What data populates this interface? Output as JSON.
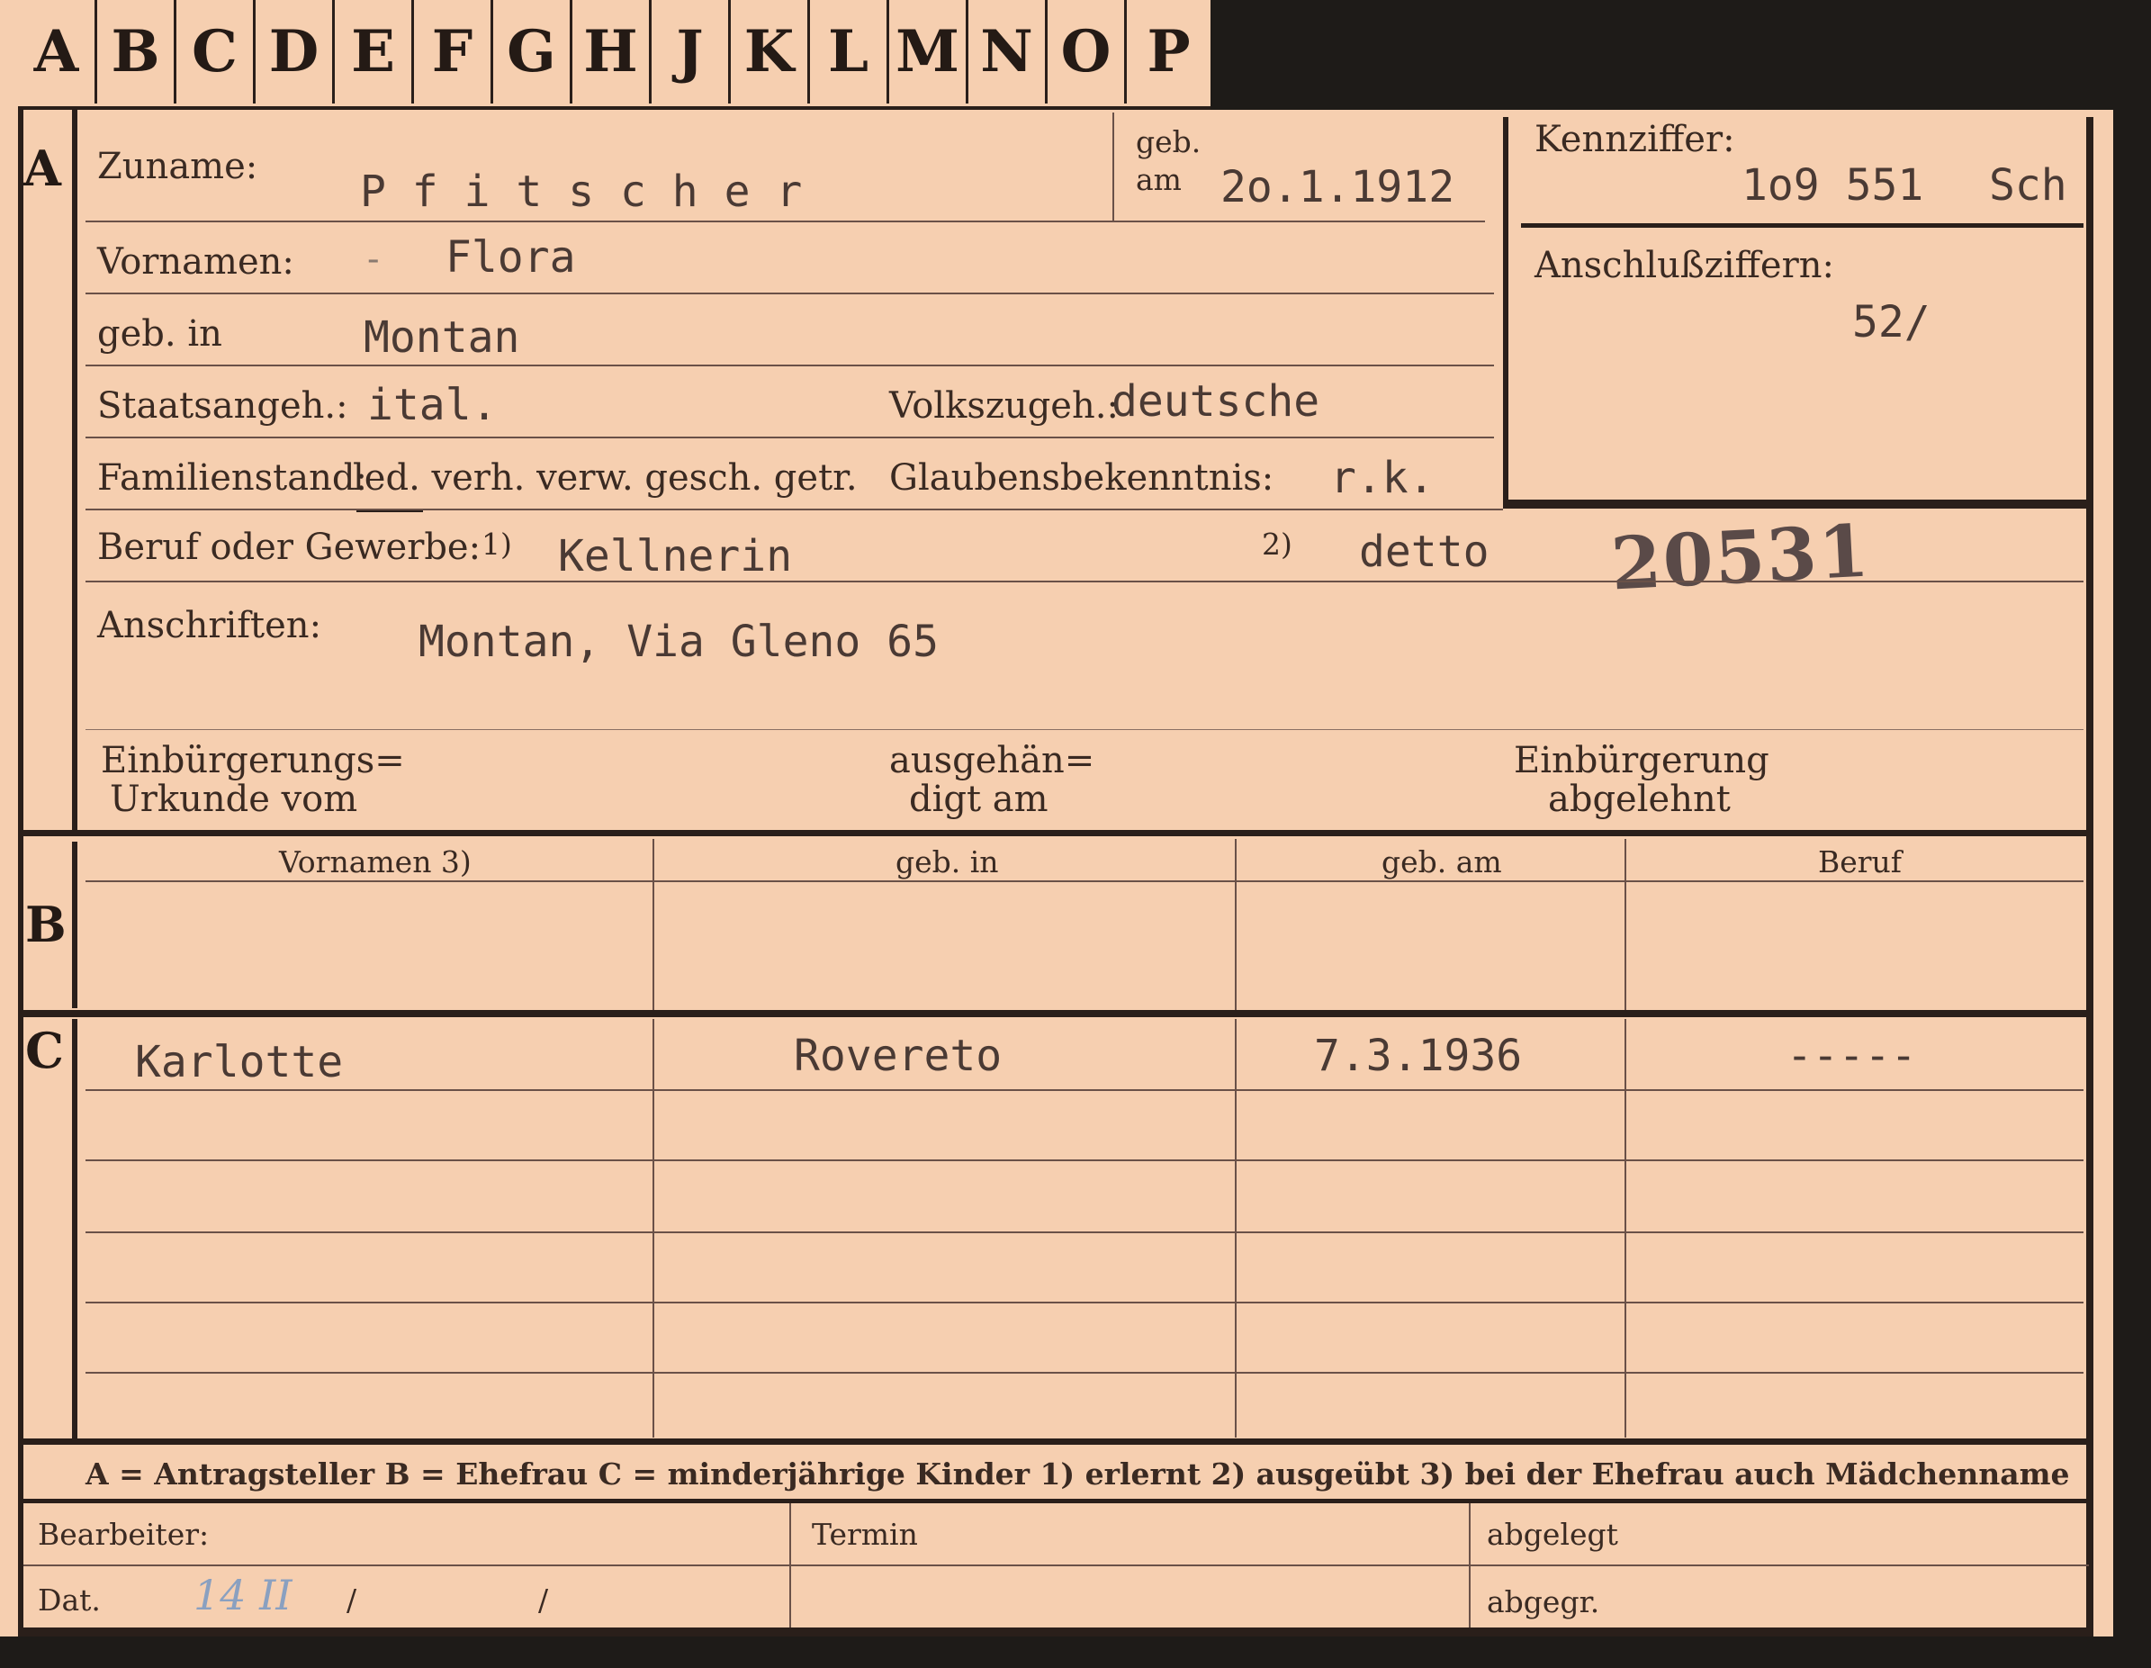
{
  "tabs": [
    "A",
    "B",
    "C",
    "D",
    "E",
    "F",
    "G",
    "H",
    "J",
    "K",
    "L",
    "M",
    "N",
    "O",
    "P"
  ],
  "sections": {
    "a": "A",
    "b": "B",
    "c": "C"
  },
  "applicant": {
    "surname_label": "Zuname:",
    "surname_value": "P f i t s c h e r",
    "born_label_top": "geb.",
    "born_label_bottom": "am",
    "born_value": "2o.1.1912",
    "first_names_label": "Vornamen:",
    "first_names_dash": "-",
    "first_names_value": "Flora",
    "birthplace_label": "geb. in",
    "birthplace_value": "Montan",
    "citizenship_label": "Staatsangeh.:",
    "citizenship_value": "ital.",
    "ethnicity_label": "Volkszugeh.:",
    "ethnicity_value": "deutsche",
    "marital_label": "Familienstand:",
    "marital_options": "led. verh. verw. gesch. getr.",
    "religion_label": "Glaubensbekenntnis:",
    "religion_value": "r.k.",
    "occupation_label": "Beruf oder Gewerbe:",
    "occupation_note1": "1)",
    "occupation_value": "Kellnerin",
    "occupation_note2": "2)",
    "occupation_value2": "detto",
    "address_label": "Anschriften:",
    "address_value": "Montan, Via Gleno 65",
    "naturalization_doc_label_1": "Einbürgerungs=",
    "naturalization_doc_label_2": "Urkunde vom",
    "handed_label_1": "ausgehän=",
    "handed_label_2": "digt am",
    "rejected_label_1": "Einbürgerung",
    "rejected_label_2": "abgelehnt"
  },
  "id_box": {
    "code_label": "Kennziffer:",
    "code_value": "1o9 551",
    "code_suffix": "Sch",
    "link_label": "Anschlußziffern:",
    "link_value": "52/"
  },
  "stamp_number": "20531",
  "table": {
    "headers": [
      "Vornamen 3)",
      "geb. in",
      "geb. am",
      "Beruf"
    ],
    "children": [
      {
        "first_name": "Karlotte",
        "birthplace": "Rovereto",
        "birthdate": "7.3.1936",
        "occupation": "-----"
      }
    ]
  },
  "legend": "A = Antragsteller   B = Ehefrau   C = minderjährige Kinder   1) erlernt   2) ausgeübt   3) bei der Ehefrau auch Mädchenname",
  "footer": {
    "processor_label": "Bearbeiter:",
    "date_label": "Dat.",
    "date_handwritten": "14 II",
    "date_slash1": "/",
    "date_slash2": "/",
    "deadline_label": "Termin",
    "filed_label": "abgelegt",
    "sent_label": "abgegr."
  }
}
